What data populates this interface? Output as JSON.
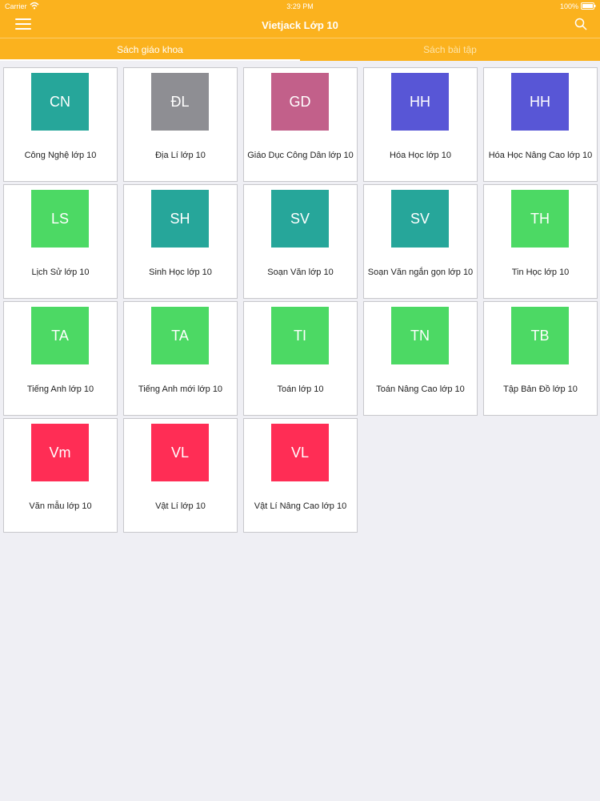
{
  "status_bar": {
    "carrier": "Carrier",
    "time": "3:29 PM",
    "battery": "100%"
  },
  "nav": {
    "title": "Vietjack Lớp 10",
    "menu_icon": "hamburger-menu-icon",
    "search_icon": "search-icon"
  },
  "tabs": [
    {
      "label": "Sách giáo khoa",
      "active": true
    },
    {
      "label": "Sách bài tập",
      "active": false
    }
  ],
  "colors": {
    "header": "#fbb21e",
    "teal": "#26a69a",
    "gray": "#8e8e93",
    "mauve": "#c2608a",
    "indigo": "#5856d6",
    "green": "#4cd964",
    "red": "#ff2d55"
  },
  "subjects": [
    {
      "abbr": "CN",
      "label": "Công Nghệ lớp 10",
      "color": "#26a69a"
    },
    {
      "abbr": "ĐL",
      "label": "Địa Lí lớp 10",
      "color": "#8e8e93"
    },
    {
      "abbr": "GD",
      "label": "Giáo Dục Công Dân lớp 10",
      "color": "#c2608a"
    },
    {
      "abbr": "HH",
      "label": "Hóa Học lớp 10",
      "color": "#5856d6"
    },
    {
      "abbr": "HH",
      "label": "Hóa Học Nâng Cao lớp 10",
      "color": "#5856d6"
    },
    {
      "abbr": "LS",
      "label": "Lịch Sử lớp 10",
      "color": "#4cd964"
    },
    {
      "abbr": "SH",
      "label": "Sinh Học lớp 10",
      "color": "#26a69a"
    },
    {
      "abbr": "SV",
      "label": "Soạn Văn lớp 10",
      "color": "#26a69a"
    },
    {
      "abbr": "SV",
      "label": "Soạn Văn ngắn gọn lớp 10",
      "color": "#26a69a"
    },
    {
      "abbr": "TH",
      "label": "Tin Học lớp 10",
      "color": "#4cd964"
    },
    {
      "abbr": "TA",
      "label": "Tiếng Anh lớp 10",
      "color": "#4cd964"
    },
    {
      "abbr": "TA",
      "label": "Tiếng Anh mới lớp 10",
      "color": "#4cd964"
    },
    {
      "abbr": "TI",
      "label": "Toán lớp 10",
      "color": "#4cd964"
    },
    {
      "abbr": "TN",
      "label": "Toán Nâng Cao lớp 10",
      "color": "#4cd964"
    },
    {
      "abbr": "TB",
      "label": "Tập Bản Đồ lớp 10",
      "color": "#4cd964"
    },
    {
      "abbr": "Vm",
      "label": "Văn mẫu lớp 10",
      "color": "#ff2d55"
    },
    {
      "abbr": "VL",
      "label": "Vật Lí lớp 10",
      "color": "#ff2d55"
    },
    {
      "abbr": "VL",
      "label": "Vật Lí Nâng Cao lớp 10",
      "color": "#ff2d55"
    }
  ]
}
